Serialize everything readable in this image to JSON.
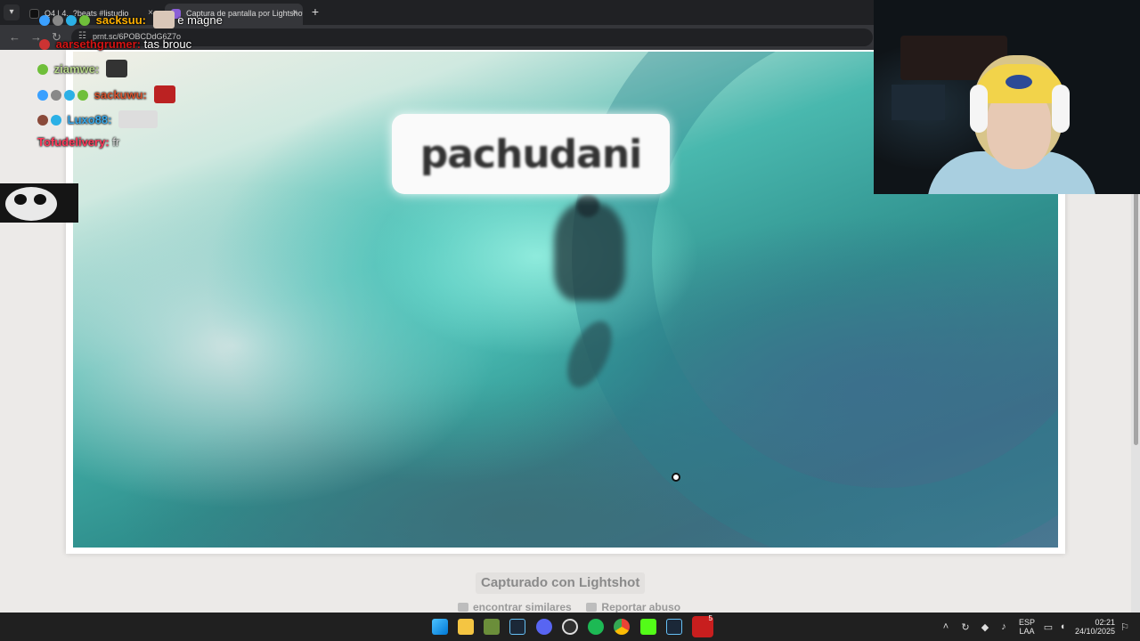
{
  "browser": {
    "tabs": [
      {
        "title": "Q4 | 4.. ?beats #listudio",
        "favicon": "tiktok-icon"
      },
      {
        "title": "Captura de pantalla por Lightshot",
        "favicon": "lightshot-icon"
      }
    ],
    "new_tab": "+",
    "address": "prnt.sc/6POBCDdG6Z7o"
  },
  "screenshot": {
    "caption": "pachudani"
  },
  "lightshot": {
    "captured_label": "Capturado con Lightshot",
    "find_similar": "encontrar similares",
    "report": "Reportar abuso"
  },
  "chat": [
    {
      "user": "sacksuu:",
      "message": "e magne",
      "color": "#ffb000"
    },
    {
      "user": "aarsethgrumer:",
      "message": "tas brouc",
      "color": "#d31313"
    },
    {
      "user": "ziamwe:",
      "message": "",
      "color": "#b5d48a"
    },
    {
      "user": "sackuwu:",
      "message": "",
      "color": "#d6522e"
    },
    {
      "user": "Luxo88:",
      "message": "",
      "color": "#37a7e8"
    },
    {
      "user": "Tofudelivery:",
      "message": "fr",
      "color": "#ff3b5c"
    }
  ],
  "taskbar": {
    "apps": [
      "windows-start",
      "file-explorer",
      "minecraft",
      "steam",
      "discord",
      "obs",
      "spotify",
      "chrome",
      "kick",
      "steam-2",
      "app-red"
    ],
    "notification_count": "5",
    "language": "ESP",
    "layout": "LAA",
    "time": "02:21",
    "date": "24/10/2025"
  }
}
